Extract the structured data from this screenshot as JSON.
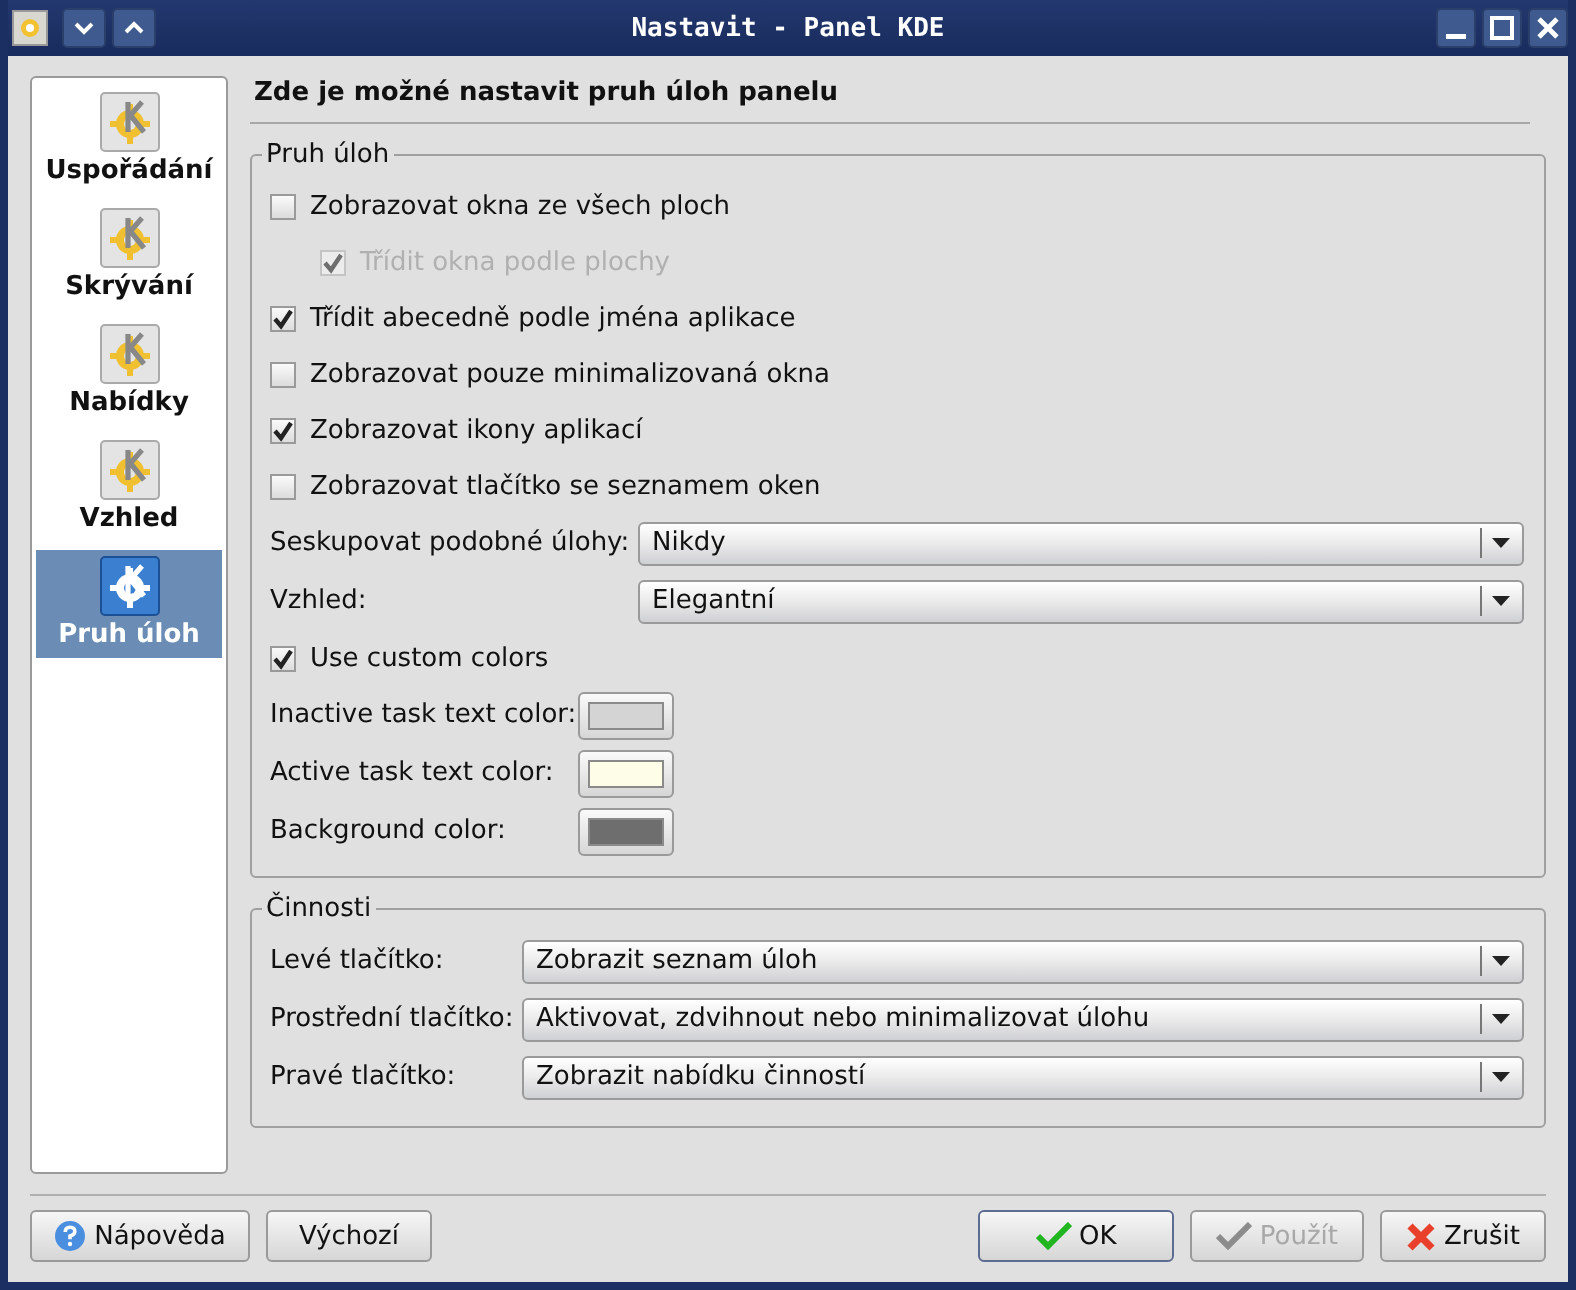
{
  "window": {
    "title": "Nastavit - Panel KDE"
  },
  "sidebar": {
    "items": [
      {
        "label": "Uspořádání",
        "selected": false
      },
      {
        "label": "Skrývání",
        "selected": false
      },
      {
        "label": "Nabídky",
        "selected": false
      },
      {
        "label": "Vzhled",
        "selected": false
      },
      {
        "label": "Pruh úloh",
        "selected": true
      }
    ]
  },
  "heading": "Zde je možné nastavit pruh úloh panelu",
  "taskbar_group": {
    "title": "Pruh úloh",
    "items": [
      {
        "kind": "checkbox",
        "label": "Zobrazovat okna ze všech ploch",
        "checked": false,
        "disabled": false,
        "children": [
          {
            "kind": "checkbox",
            "label": "Třídit okna podle plochy",
            "checked": true,
            "disabled": true
          }
        ]
      },
      {
        "kind": "checkbox",
        "label": "Třídit abecedně podle jména aplikace",
        "checked": true,
        "disabled": false
      },
      {
        "kind": "checkbox",
        "label": "Zobrazovat pouze minimalizovaná okna",
        "checked": false,
        "disabled": false
      },
      {
        "kind": "checkbox",
        "label": "Zobrazovat ikony aplikací",
        "checked": true,
        "disabled": false
      },
      {
        "kind": "checkbox",
        "label": "Zobrazovat tlačítko se seznamem oken",
        "checked": false,
        "disabled": false
      },
      {
        "kind": "combo",
        "label": "Seskupovat podobné úlohy:",
        "value": "Nikdy"
      },
      {
        "kind": "combo",
        "label": "Vzhled:",
        "value": "Elegantní"
      },
      {
        "kind": "checkbox",
        "label": "Use custom colors",
        "checked": true,
        "disabled": false
      },
      {
        "kind": "color",
        "label": "Inactive task text color:",
        "color": "#d4d4d4"
      },
      {
        "kind": "color",
        "label": "Active task text color:",
        "color": "#fdfde8"
      },
      {
        "kind": "color",
        "label": "Background color:",
        "color": "#6e6e6e"
      }
    ]
  },
  "actions_group": {
    "title": "Činnosti",
    "items": [
      {
        "kind": "combo",
        "label": "Levé tlačítko:",
        "value": "Zobrazit seznam úloh"
      },
      {
        "kind": "combo",
        "label": "Prostřední tlačítko:",
        "value": "Aktivovat, zdvihnout nebo minimalizovat úlohu"
      },
      {
        "kind": "combo",
        "label": "Pravé tlačítko:",
        "value": "Zobrazit nabídku činností"
      }
    ]
  },
  "buttons_left": [
    {
      "kind": "help",
      "label": "Nápověda",
      "disabled": false,
      "default": false
    },
    {
      "kind": "plain",
      "label": "Výchozí",
      "disabled": false,
      "default": false
    }
  ],
  "buttons_right": [
    {
      "kind": "ok",
      "label": "OK",
      "disabled": false,
      "default": true
    },
    {
      "kind": "apply",
      "label": "Použít",
      "disabled": true,
      "default": false
    },
    {
      "kind": "cancel",
      "label": "Zrušit",
      "disabled": false,
      "default": false
    }
  ]
}
